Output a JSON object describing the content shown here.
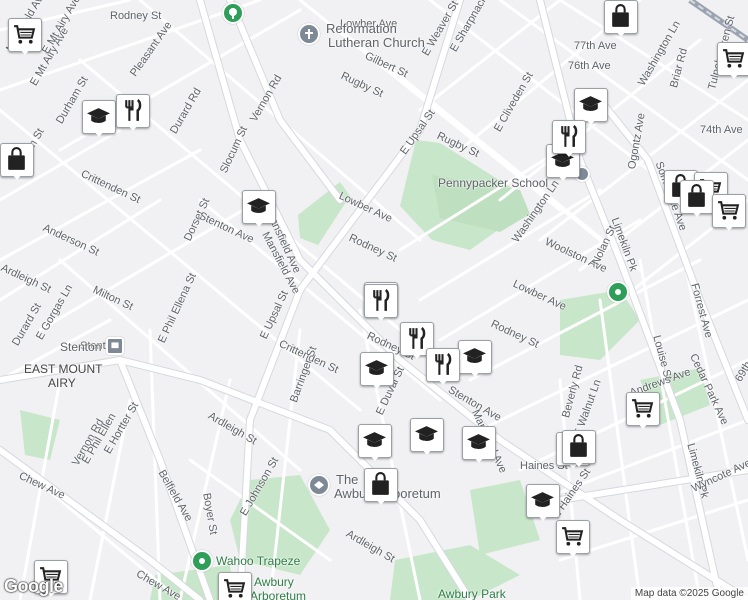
{
  "map": {
    "attribution": "Map data ©2025 Google",
    "logo": "Google",
    "colors": {
      "background": "#f1f1f4",
      "road": "#ffffff",
      "road_outline": "#d5d8de",
      "park": "#c8e6c9",
      "rail": "#b0b5bf",
      "poi_green": "#2e9e58",
      "poi_gray": "#7d8a96"
    },
    "street_labels": [
      {
        "text": "Rodney St"
      },
      {
        "text": "Lowber Ave"
      },
      {
        "text": "Pleasant Ave"
      },
      {
        "text": "E Mt Airy Ave"
      },
      {
        "text": "Mansfield Ave"
      },
      {
        "text": "Vernon Rd"
      },
      {
        "text": "Durham St"
      },
      {
        "text": "Durard Rd"
      },
      {
        "text": "Crittenden St"
      },
      {
        "text": "Slocum St"
      },
      {
        "text": "Dorset St"
      },
      {
        "text": "Stenton Ave"
      },
      {
        "text": "Anderson St"
      },
      {
        "text": "Ardleigh St"
      },
      {
        "text": "Milton St"
      },
      {
        "text": "E Phil Ellena St"
      },
      {
        "text": "E Upsal St"
      },
      {
        "text": "Mansfield Ave"
      },
      {
        "text": "Rodney St"
      },
      {
        "text": "Lowber Ave"
      },
      {
        "text": "Rugby St"
      },
      {
        "text": "Gilbert St"
      },
      {
        "text": "E Weaver St"
      },
      {
        "text": "E Sharpnack St"
      },
      {
        "text": "E Upsal St"
      },
      {
        "text": "Rugby St"
      },
      {
        "text": "E Cliveden St"
      },
      {
        "text": "77th Ave"
      },
      {
        "text": "76th Ave"
      },
      {
        "text": "Washington Ln"
      },
      {
        "text": "Briar Rd"
      },
      {
        "text": "Tulpehocken St"
      },
      {
        "text": "74th Ave"
      },
      {
        "text": "Ogontz Ave"
      },
      {
        "text": "Washington Ln"
      },
      {
        "text": "Woolston Ave"
      },
      {
        "text": "Nolan St"
      },
      {
        "text": "Limekiln Pk"
      },
      {
        "text": "Lowber Ave"
      },
      {
        "text": "Rodney St"
      },
      {
        "text": "Forrest Ave"
      },
      {
        "text": "Cedar Park Ave"
      },
      {
        "text": "Louise St"
      },
      {
        "text": "Andrews Ave"
      },
      {
        "text": "69th"
      },
      {
        "text": "Limekiln Pk"
      },
      {
        "text": "Wyncote Ave"
      },
      {
        "text": "Crittenden St"
      },
      {
        "text": "E Duval St"
      },
      {
        "text": "Stenton Ave"
      },
      {
        "text": "Mansfield Ave"
      },
      {
        "text": "Beverly Rd"
      },
      {
        "text": "E Walnut Ln"
      },
      {
        "text": "Haines St"
      },
      {
        "text": "E Haines St"
      },
      {
        "text": "Barringer St"
      },
      {
        "text": "E Gorgas Ln"
      },
      {
        "text": "Durard St"
      },
      {
        "text": "Vernon Rd"
      },
      {
        "text": "E Phil Ellen"
      },
      {
        "text": "E Hortter St"
      },
      {
        "text": "Belfield Ave"
      },
      {
        "text": "Chew Ave"
      },
      {
        "text": "Boyer St"
      },
      {
        "text": "E Johnson St"
      },
      {
        "text": "Ardleigh St"
      },
      {
        "text": "Ardleigh St"
      },
      {
        "text": "Chew Ave"
      },
      {
        "text": "Stenton"
      },
      {
        "text": "Durham St"
      },
      {
        "text": "Rodney St"
      },
      {
        "text": "Mansfield Ave"
      },
      {
        "text": "E Mt Airy Ave"
      },
      {
        "text": "Somerville Ave"
      }
    ],
    "place_labels": [
      {
        "text": "Reformation",
        "color": "#5f6368"
      },
      {
        "text": "Lutheran Church",
        "color": "#5f6368"
      },
      {
        "text": "Pennypacker School",
        "color": "#5f6368"
      },
      {
        "text": "EAST MOUNT",
        "color": "#444"
      },
      {
        "text": "AIRY",
        "color": "#444"
      },
      {
        "text": "The",
        "color": "#5f6368"
      },
      {
        "text": "Awbury Arboretum",
        "color": "#5f6368"
      },
      {
        "text": "Wahoo Trapeze",
        "color": "#2e7d46"
      },
      {
        "text": "Awbury",
        "color": "#2e7d46"
      },
      {
        "text": "Arboretum",
        "color": "#2e7d46"
      },
      {
        "text": "Awbury Park",
        "color": "#2e7d46"
      },
      {
        "text": "Stenton",
        "color": "#5f6368"
      }
    ],
    "markers": [
      {
        "icon": "shopping-cart-icon"
      },
      {
        "icon": "shopping-bag-icon"
      },
      {
        "icon": "shopping-cart-icon"
      },
      {
        "icon": "graduation-cap-icon"
      },
      {
        "icon": "restaurant-icon"
      },
      {
        "icon": "shopping-bag-icon"
      },
      {
        "icon": "graduation-cap-icon"
      },
      {
        "icon": "restaurant-icon"
      },
      {
        "icon": "graduation-cap-icon"
      },
      {
        "icon": "graduation-cap-icon"
      },
      {
        "icon": "restaurant-icon"
      },
      {
        "icon": "shopping-bag-icon"
      },
      {
        "icon": "shopping-cart-icon"
      },
      {
        "icon": "shopping-bag-icon"
      },
      {
        "icon": "shopping-cart-icon"
      },
      {
        "icon": "restaurant-icon"
      },
      {
        "icon": "restaurant-icon"
      },
      {
        "icon": "graduation-cap-icon"
      },
      {
        "icon": "graduation-cap-icon"
      },
      {
        "icon": "restaurant-icon"
      },
      {
        "icon": "graduation-cap-icon"
      },
      {
        "icon": "graduation-cap-icon"
      },
      {
        "icon": "graduation-cap-icon"
      },
      {
        "icon": "shopping-bag-icon"
      },
      {
        "icon": "shopping-bag-icon"
      },
      {
        "icon": "shopping-cart-icon"
      },
      {
        "icon": "shopping-bag-icon"
      },
      {
        "icon": "graduation-cap-icon"
      },
      {
        "icon": "shopping-cart-icon"
      },
      {
        "icon": "shopping-cart-icon"
      },
      {
        "icon": "shopping-cart-icon"
      }
    ]
  }
}
